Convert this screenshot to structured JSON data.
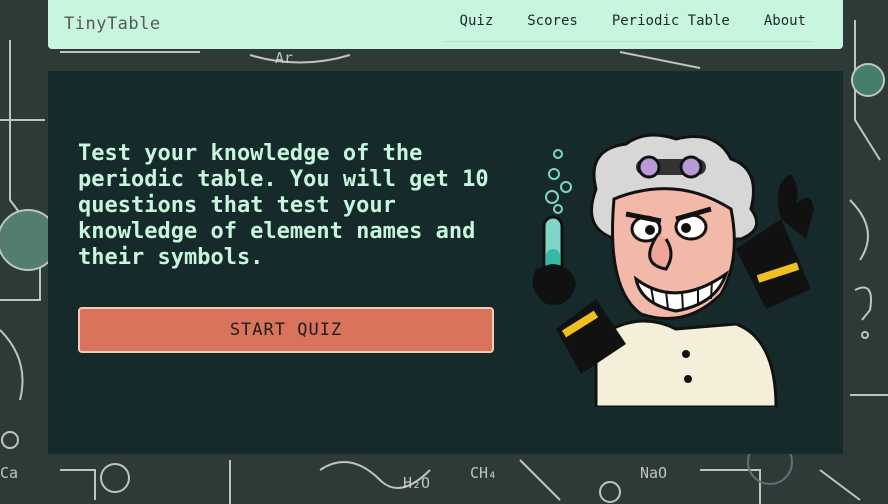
{
  "brand": {
    "name": "TinyTable"
  },
  "nav": {
    "items": [
      {
        "label": "Quiz"
      },
      {
        "label": "Scores"
      },
      {
        "label": "Periodic Table"
      },
      {
        "label": "About"
      }
    ]
  },
  "hero": {
    "intro": "Test your knowledge of the periodic table. You will get 10 questions that test your knowledge of element names and their symbols.",
    "start_label": "START QUIZ"
  },
  "background_doodle_text": [
    "Ar",
    "H₂O",
    "CH₄",
    "NaO",
    "Ca"
  ],
  "colors": {
    "navbar": "#c8f5dd",
    "panel": "#172a2b",
    "intro_text": "#c8f5dd",
    "button": "#d9735b",
    "background": "#2e3a38"
  },
  "icons": {
    "illustration": "mad-scientist-illustration"
  }
}
